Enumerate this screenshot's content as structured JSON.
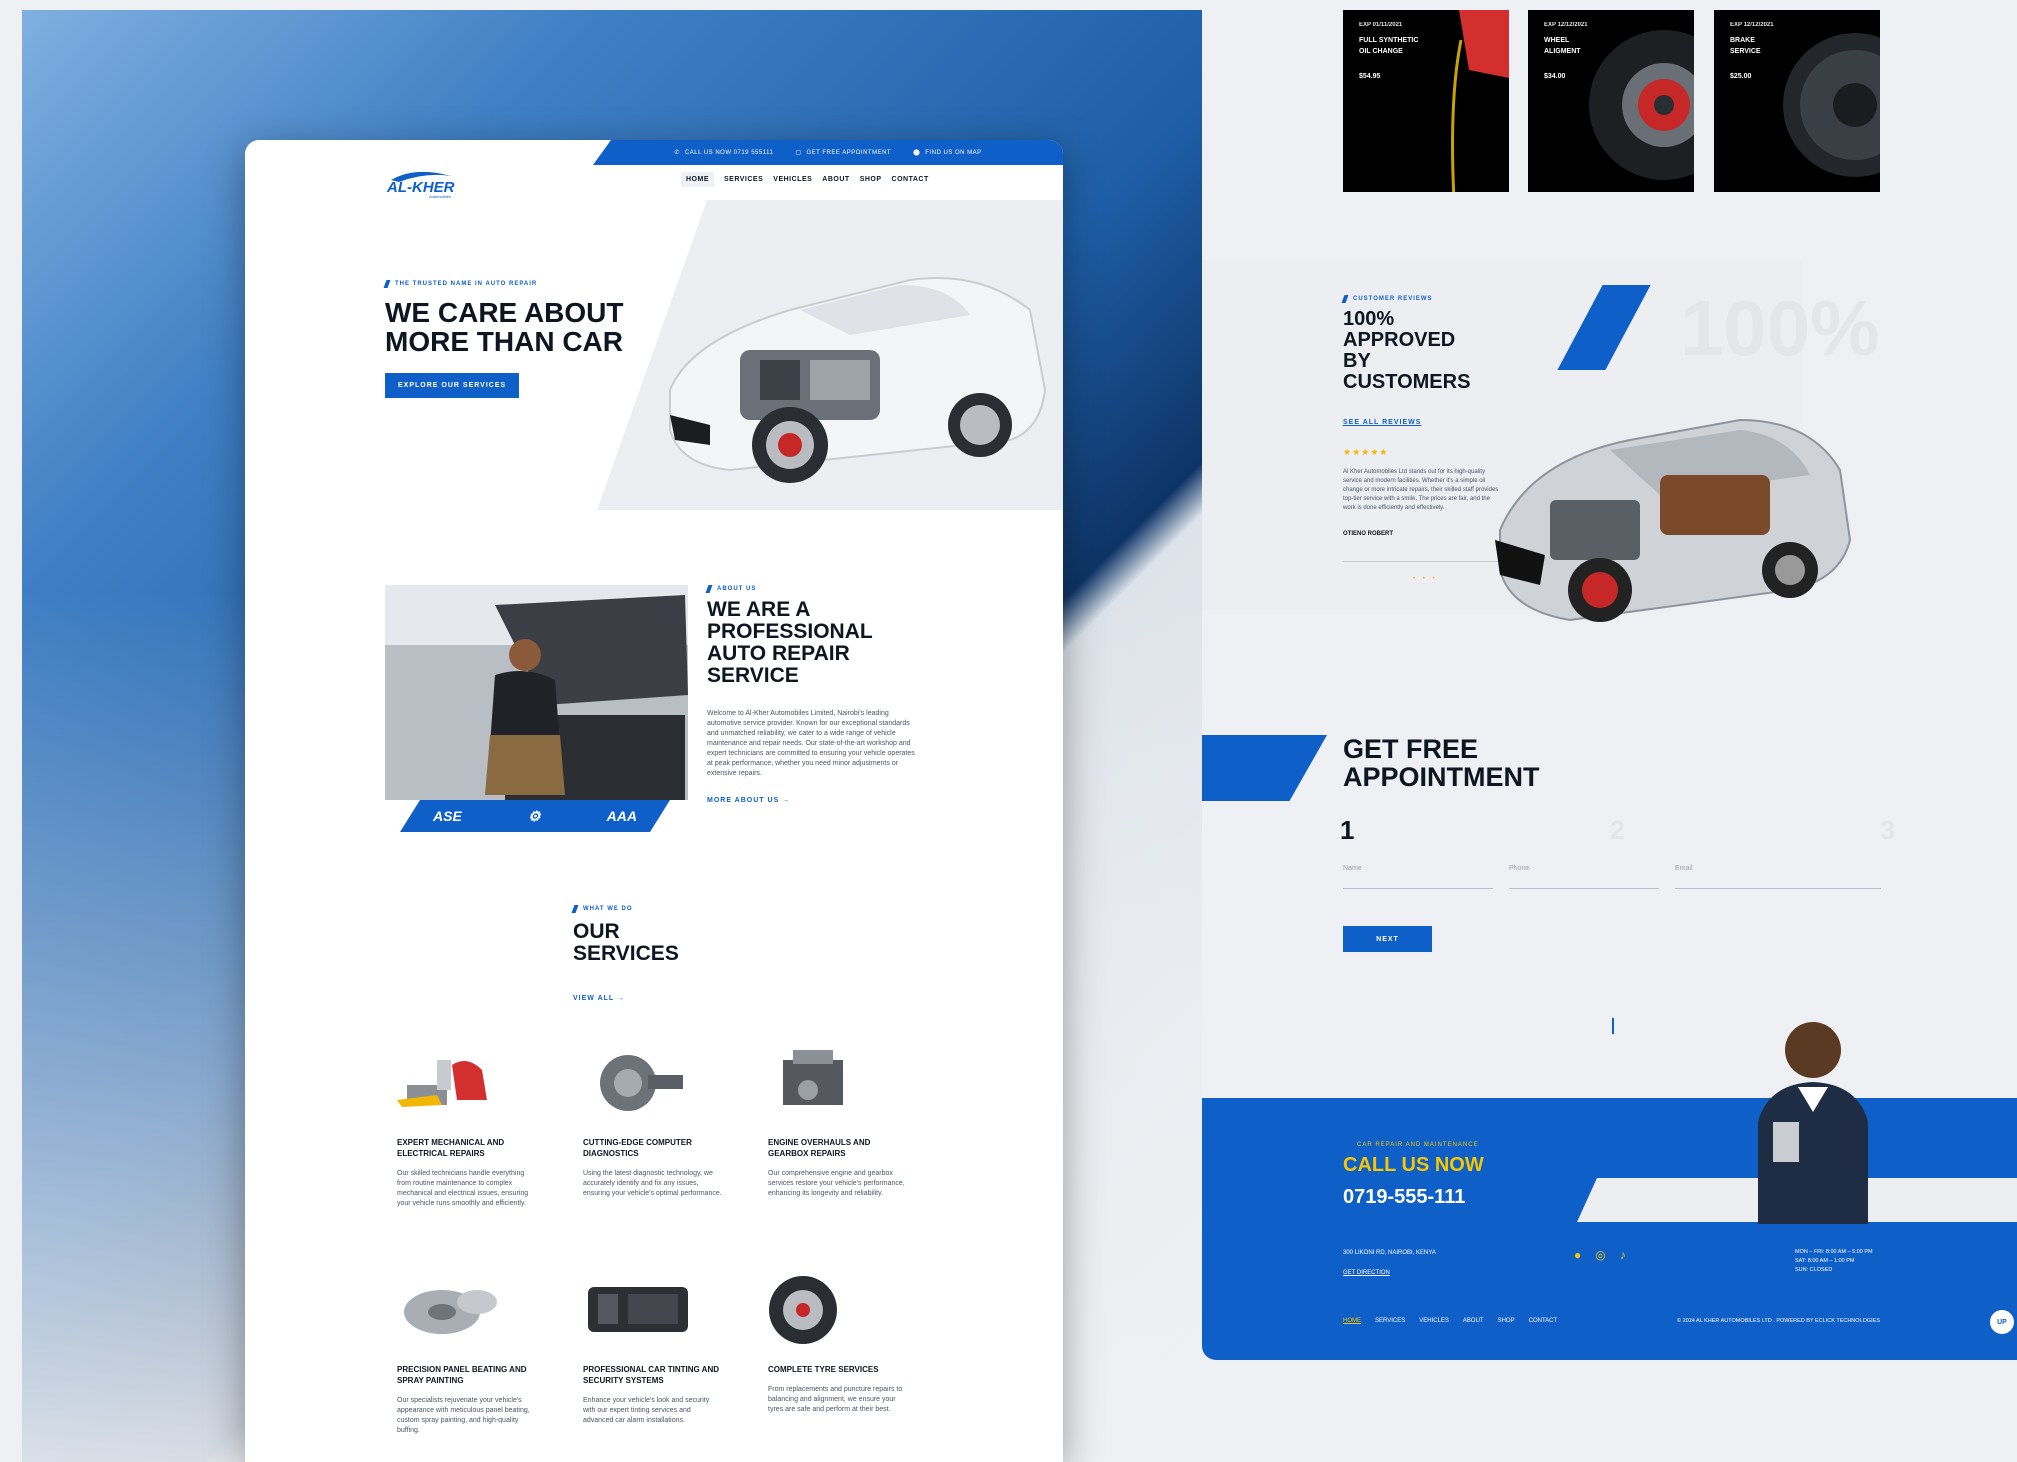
{
  "topbar": {
    "call": "CALL US NOW 0719 555111",
    "appointment": "GET FREE APPOINTMENT",
    "map": "FIND US ON MAP"
  },
  "brand": {
    "name": "AL-KHER",
    "sub": "Automobiles"
  },
  "nav": [
    "HOME",
    "SERVICES",
    "VEHICLES",
    "ABOUT",
    "SHOP",
    "CONTACT"
  ],
  "hero": {
    "eyebrow": "THE TRUSTED NAME IN AUTO REPAIR",
    "title_line1": "WE CARE ABOUT",
    "title_line2": "MORE THAN CAR",
    "button": "EXPLORE OUR SERVICES"
  },
  "about": {
    "badges": [
      "ASE",
      "⚙",
      "AAA"
    ],
    "eyebrow": "ABOUT US",
    "title": [
      "WE ARE A",
      "PROFESSIONAL",
      "AUTO REPAIR",
      "SERVICE"
    ],
    "text": "Welcome to Al-Kher Automobiles Limited, Nairobi's leading automotive service provider. Known for our exceptional standards and unmatched reliability, we cater to a wide range of vehicle maintenance and repair needs. Our state-of-the-art workshop and expert technicians are committed to ensuring your vehicle operates at peak performance, whether you need minor adjustments or extensive repairs.",
    "link": "MORE ABOUT US →"
  },
  "services": {
    "eyebrow": "WHAT WE DO",
    "title": [
      "OUR",
      "SERVICES"
    ],
    "link": "VIEW ALL →",
    "items": [
      {
        "title": "EXPERT MECHANICAL AND ELECTRICAL REPAIRS",
        "text": "Our skilled technicians handle everything from routine maintenance to complex mechanical and electrical issues, ensuring your vehicle runs smoothly and efficiently."
      },
      {
        "title": "CUTTING-EDGE COMPUTER DIAGNOSTICS",
        "text": "Using the latest diagnostic technology, we accurately identify and fix any issues, ensuring your vehicle's optimal performance."
      },
      {
        "title": "ENGINE OVERHAULS AND GEARBOX REPAIRS",
        "text": "Our comprehensive engine and gearbox services restore your vehicle's performance, enhancing its longevity and reliability."
      },
      {
        "title": "PRECISION PANEL BEATING AND SPRAY PAINTING",
        "text": "Our specialists rejuvenate your vehicle's appearance with meticulous panel beating, custom spray painting, and high-quality buffing."
      },
      {
        "title": "PROFESSIONAL CAR TINTING AND SECURITY SYSTEMS",
        "text": "Enhance your vehicle's look and security with our expert tinting services and advanced car alarm installations."
      },
      {
        "title": "COMPLETE TYRE SERVICES",
        "text": "From replacements and puncture repairs to balancing and alignment, we ensure your tyres are safe and perform at their best."
      }
    ]
  },
  "promos": [
    {
      "exp": "EXP 01/11/2021",
      "title": [
        "FULL SYNTHETIC",
        "OIL CHANGE"
      ],
      "price": "$54.95"
    },
    {
      "exp": "EXP 12/12/2021",
      "title": [
        "WHEEL",
        "ALIGMENT"
      ],
      "price": "$34.00"
    },
    {
      "exp": "EXP 12/12/2021",
      "title": [
        "BRAKE",
        "SERVICE"
      ],
      "price": "$25.00"
    }
  ],
  "reviews": {
    "eyebrow": "CUSTOMER REVIEWS",
    "title": [
      "100% APPROVED",
      "BY CUSTOMERS"
    ],
    "link": "SEE ALL REVIEWS",
    "stars": "★★★★★",
    "big": "100%",
    "quote": "Al Kher Automobiles Ltd stands out for its high-quality service and modern facilities. Whether it's a simple oil change or more intricate repairs, their skilled staff provides top-tier service with a smile. The prices are fair, and the work is done efficiently and effectively.",
    "author": "OTIENO ROBERT",
    "dots": "• • •"
  },
  "appointment": {
    "title": [
      "GET FREE",
      "APPOINTMENT"
    ],
    "steps": [
      "1",
      "2",
      "3"
    ],
    "fields": [
      "Name",
      "Phone",
      "Email"
    ],
    "button": "NEXT"
  },
  "footer": {
    "eyebrow": "CAR REPAIR AND MAINTENANCE",
    "call": "CALL US NOW",
    "phone": "0719-555-111",
    "address": "300 LIKONI RD, NAIROBI, KENYA",
    "directions": "GET DIRECTION",
    "hours": [
      "MON – FRI: 8:00 AM – 5:00 PM",
      "SAT: 8:00 AM – 1:00 PM",
      "SUN: CLOSED"
    ],
    "nav": [
      "HOME",
      "SERVICES",
      "VEHICLES",
      "ABOUT",
      "SHOP",
      "CONTACT"
    ],
    "copyright": "© 2024 AL KHER AUTOMOBILES LTD . POWERED BY ECLICK TECHNOLOGIES",
    "up": "UP"
  },
  "colors": {
    "accent": "#0e5fc8",
    "yellow": "#f7c600",
    "dark": "#0e1622"
  }
}
